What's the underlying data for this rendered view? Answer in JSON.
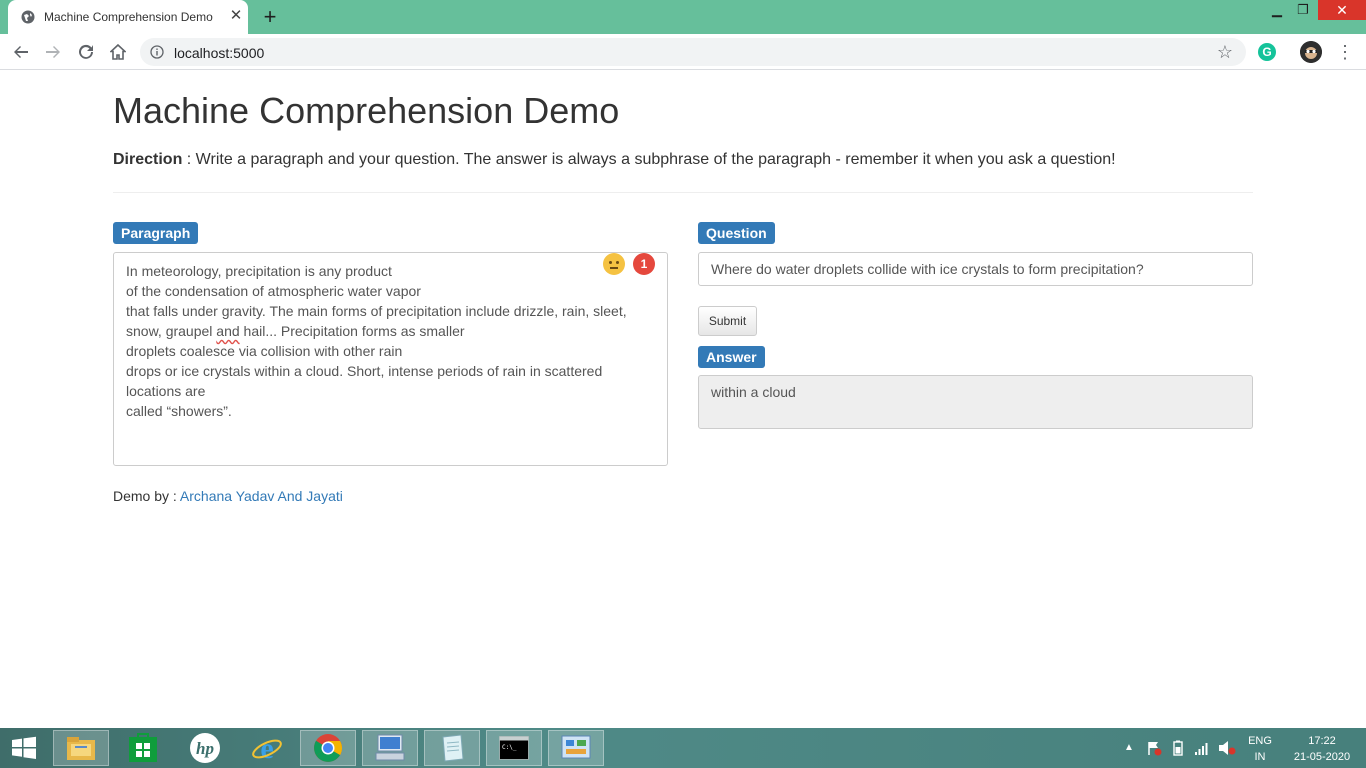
{
  "browser": {
    "tab_title": "Machine Comprehension Demo",
    "url": "localhost:5000",
    "extension_badge": "G"
  },
  "page": {
    "title": "Machine Comprehension Demo",
    "direction_label": "Direction",
    "direction_text": " : Write a paragraph and your question. The answer is always a subphrase of the paragraph - remember it when you ask a question!",
    "paragraph_label": "Paragraph",
    "paragraph_before": "In meteorology, precipitation is any product\nof the condensation of atmospheric water vapor\nthat falls under gravity. The main forms of precipitation include drizzle, rain, sleet,\nsnow, graupel ",
    "paragraph_flagged_word": "and",
    "paragraph_after": " hail... Precipitation forms as smaller\ndroplets coalesce via collision with other rain\ndrops or ice crystals within a cloud. Short, intense periods of rain in scattered\nlocations are\ncalled “showers”.",
    "grammarly_count": "1",
    "question_label": "Question",
    "question_value": "Where do water droplets collide with ice crystals to form precipitation?",
    "submit_label": "Submit",
    "answer_label": "Answer",
    "answer_value": "within a cloud",
    "footer_prefix": "Demo by : ",
    "footer_link": "Archana Yadav And Jayati"
  },
  "taskbar": {
    "items": [
      "file-explorer-icon",
      "store-icon",
      "hp-icon",
      "internet-explorer-icon",
      "chrome-icon",
      "remote-desktop-icon",
      "notepad-icon",
      "command-prompt-icon",
      "control-panel-icon"
    ],
    "lang_top": "ENG",
    "lang_bottom": "IN",
    "time": "17:22",
    "date": "21-05-2020"
  },
  "colors": {
    "title_bar": "#66bf9b",
    "badge": "#337ab7",
    "link": "#337ab7",
    "close": "#d9352a"
  }
}
